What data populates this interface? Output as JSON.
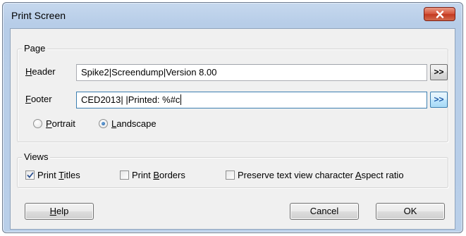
{
  "window": {
    "title": "Print Screen",
    "close_icon": "close-x-icon"
  },
  "page_group": {
    "label": "Page",
    "header_label": "Header",
    "header_mnemonic": "H",
    "header_rest": "eader",
    "header_value": "Spike2|Screendump|Version 8.00",
    "footer_label": "Footer",
    "footer_mnemonic": "F",
    "footer_rest": "ooter",
    "footer_value": "CED2013| |Printed: %#c",
    "insert_button_label": ">>",
    "orientation": {
      "portrait_mnemonic": "P",
      "portrait_rest": "ortrait",
      "landscape_mnemonic": "L",
      "landscape_rest": "andscape",
      "selected": "Landscape"
    }
  },
  "views_group": {
    "label": "Views",
    "print_titles": {
      "before": "Print ",
      "mnemonic": "T",
      "after": "itles",
      "checked": true
    },
    "print_borders": {
      "before": "Print ",
      "mnemonic": "B",
      "after": "orders",
      "checked": false
    },
    "preserve_aspect": {
      "before": "Preserve text view character ",
      "mnemonic": "A",
      "after": "spect ratio",
      "checked": false
    }
  },
  "buttons": {
    "help_mnemonic": "H",
    "help_rest": "elp",
    "cancel": "Cancel",
    "ok": "OK"
  },
  "colors": {
    "accent": "#3c7fb1",
    "close_button": "#c33a20",
    "frame": "#b9cfe9"
  }
}
